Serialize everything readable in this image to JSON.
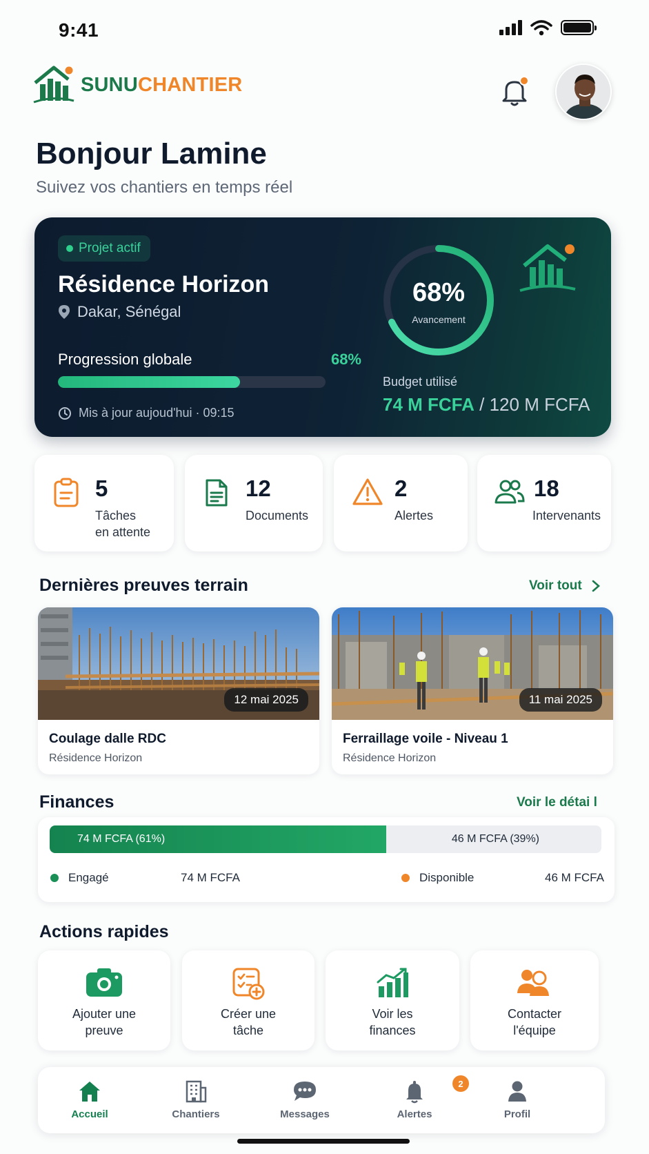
{
  "status_bar": {
    "time": "9:41"
  },
  "brand": {
    "word1": "SUNU",
    "word2": "CHANTIER",
    "primary": "#1c7a4a",
    "accent": "#f0862a"
  },
  "header": {
    "notification_icon": "bell-icon",
    "avatar": "user-avatar"
  },
  "greeting": {
    "title": "Bonjour Lamine",
    "subtitle": "Suivez vos chantiers en temps réel"
  },
  "project": {
    "badge": "Projet actif",
    "name": "Résidence Horizon",
    "location": "Dakar, Sénégal",
    "progress_label": "Progression globale",
    "progress_value": "68%",
    "progress_fraction": 0.68,
    "updated": "Mis à jour aujoud'hui · 09:15",
    "ring_value": "68%",
    "ring_label": "Avancement",
    "budget_label": "Budget utilisé",
    "budget_used": "74 M FCFA",
    "budget_total": " / 120 M FCFA"
  },
  "stats": [
    {
      "value": "5",
      "label1": "Tâches",
      "label2": "en attente",
      "icon": "clipboard-icon"
    },
    {
      "value": "12",
      "label1": "Documents",
      "label2": "",
      "icon": "document-icon"
    },
    {
      "value": "2",
      "label1": "Alertes",
      "label2": "",
      "icon": "warning-icon"
    },
    {
      "value": "18",
      "label1": "Intervenants",
      "label2": "",
      "icon": "users-icon"
    }
  ],
  "evidence": {
    "title": "Dernières preuves terrain",
    "see_all": "Voir tout",
    "items": [
      {
        "date": "12 mai 2025",
        "title": "Coulage dalle RDC",
        "project": "Résidence Horizon"
      },
      {
        "date": "11 mai 2025",
        "title": "Ferraillage voile - Niveau 1",
        "project": "Résidence Horizon"
      }
    ]
  },
  "finances": {
    "title": "Finances",
    "detail_link": "Voir le détai l",
    "engaged_bar": "74 M FCFA (61%)",
    "available_bar": "46 M FCFA (39%)",
    "engaged_fraction": 0.61,
    "engaged_label": "Engagé",
    "engaged_amount": "74 M FCFA",
    "available_label": "Disponible",
    "available_amount": "46 M FCFA",
    "engaged_color": "#1a8f56",
    "available_color": "#f0862a"
  },
  "quick_actions": {
    "title": "Actions rapides",
    "items": [
      {
        "line1": "Ajouter une",
        "line2": "preuve",
        "icon": "camera-icon"
      },
      {
        "line1": "Créer une",
        "line2": "tâche",
        "icon": "task-add-icon"
      },
      {
        "line1": "Voir les",
        "line2": "finances",
        "icon": "chart-icon"
      },
      {
        "line1": "Contacter",
        "line2": "l'équipe",
        "icon": "contact-team-icon"
      }
    ]
  },
  "nav": {
    "items": [
      {
        "label": "Accueil",
        "icon": "home-icon"
      },
      {
        "label": "Chantiers",
        "icon": "building-icon"
      },
      {
        "label": "Messages",
        "icon": "chat-icon"
      },
      {
        "label": "Alertes",
        "icon": "bell-icon"
      },
      {
        "label": "Profil",
        "icon": "profile-icon"
      }
    ],
    "alerts_badge": "2"
  }
}
